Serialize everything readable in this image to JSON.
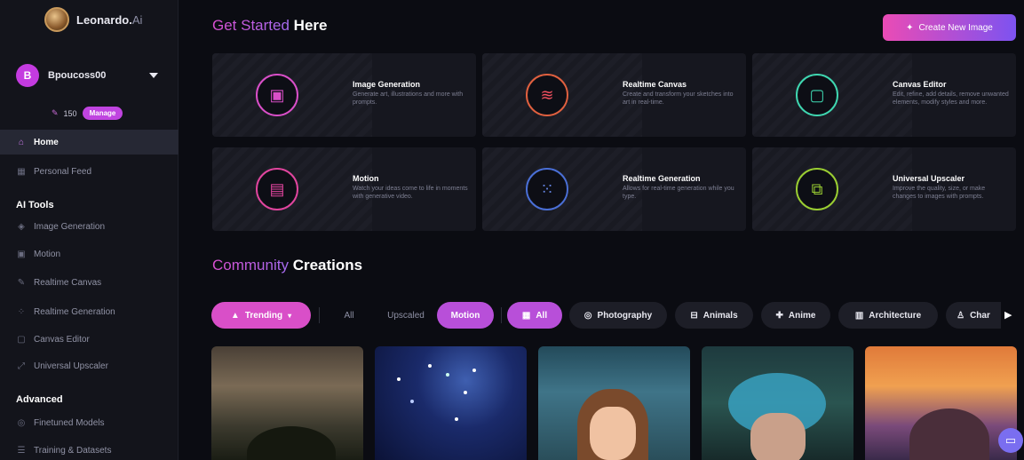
{
  "brand": {
    "name": "Leonardo.",
    "suffix": "Ai"
  },
  "user": {
    "initial": "B",
    "name": "Bpoucoss00",
    "tokens": "150",
    "manage_label": "Manage"
  },
  "sidebar": {
    "items": [
      {
        "label": "Home",
        "icon": "home-icon",
        "active": true
      },
      {
        "label": "Personal Feed",
        "icon": "feed-icon"
      }
    ],
    "ai_tools_heading": "AI Tools",
    "ai_tools": [
      {
        "label": "Image Generation",
        "icon": "image-icon"
      },
      {
        "label": "Motion",
        "icon": "motion-icon"
      },
      {
        "label": "Realtime Canvas",
        "icon": "brush-icon"
      },
      {
        "label": "Realtime Generation",
        "icon": "realtime-icon"
      },
      {
        "label": "Canvas Editor",
        "icon": "canvas-icon"
      },
      {
        "label": "Universal Upscaler",
        "icon": "upscale-icon"
      }
    ],
    "advanced_heading": "Advanced",
    "advanced": [
      {
        "label": "Finetuned Models",
        "icon": "model-icon"
      },
      {
        "label": "Training & Datasets",
        "icon": "dataset-icon"
      }
    ]
  },
  "get_started": {
    "title_accent": "Get Started",
    "title_rest": "Here",
    "create_label": "Create New Image"
  },
  "tiles": [
    {
      "title": "Image Generation",
      "desc": "Generate art, illustrations and more with prompts.",
      "icon": "image-icon",
      "color": "#d94fc8"
    },
    {
      "title": "Realtime Canvas",
      "desc": "Create and transform your sketches into art in real-time.",
      "icon": "brush-icon",
      "color": "#f0505f"
    },
    {
      "title": "Canvas Editor",
      "desc": "Edit, refine, add details, remove unwanted elements, modify styles and more.",
      "icon": "canvas-icon",
      "color": "#3fd6b0"
    },
    {
      "title": "Motion",
      "desc": "Watch your ideas come to life in moments with generative video.",
      "icon": "motion-icon",
      "color": "#e0459e"
    },
    {
      "title": "Realtime Generation",
      "desc": "Allows for real-time generation while you type.",
      "icon": "realtime-icon",
      "color": "#6a8cf0"
    },
    {
      "title": "Universal Upscaler",
      "desc": "Improve the quality, size, or make changes to images with prompts.",
      "icon": "upscale-icon",
      "color": "#9acd32"
    }
  ],
  "community": {
    "title_accent": "Community",
    "title_rest": "Creations"
  },
  "filters": {
    "trending": "Trending",
    "all": "All",
    "upscaled": "Upscaled",
    "motion": "Motion",
    "all_cat": "All",
    "categories": [
      "Photography",
      "Animals",
      "Anime",
      "Architecture",
      "Char"
    ]
  },
  "colors": {
    "accent": "#d94fc8",
    "accent2": "#7d53f0",
    "bg": "#0b0c12",
    "sidebar": "#13141b"
  }
}
